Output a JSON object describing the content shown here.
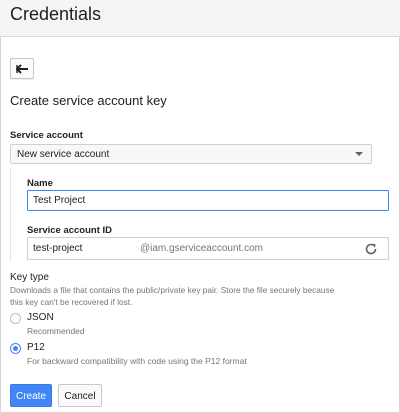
{
  "header": {
    "title": "Credentials"
  },
  "form": {
    "section_title": "Create service account key",
    "service_account": {
      "label": "Service account",
      "selected": "New service account"
    },
    "name": {
      "label": "Name",
      "value": "Test Project"
    },
    "account_id": {
      "label": "Service account ID",
      "value": "test-project",
      "suffix": "@iam.gserviceaccount.com"
    },
    "key_type": {
      "label": "Key type",
      "description_line1": "Downloads a file that contains the public/private key pair. Store the file securely because",
      "description_line2": "this key can't be recovered if lost.",
      "options": [
        {
          "label": "JSON",
          "hint": "Recommended",
          "selected": false
        },
        {
          "label": "P12",
          "hint": "For backward compatibility with code using the P12 format",
          "selected": true
        }
      ]
    }
  },
  "actions": {
    "create_label": "Create",
    "cancel_label": "Cancel"
  },
  "colors": {
    "accent": "#4285f4"
  },
  "icons": {
    "back": "back-arrow-icon",
    "refresh": "refresh-icon",
    "dropdown": "caret-down-icon"
  }
}
